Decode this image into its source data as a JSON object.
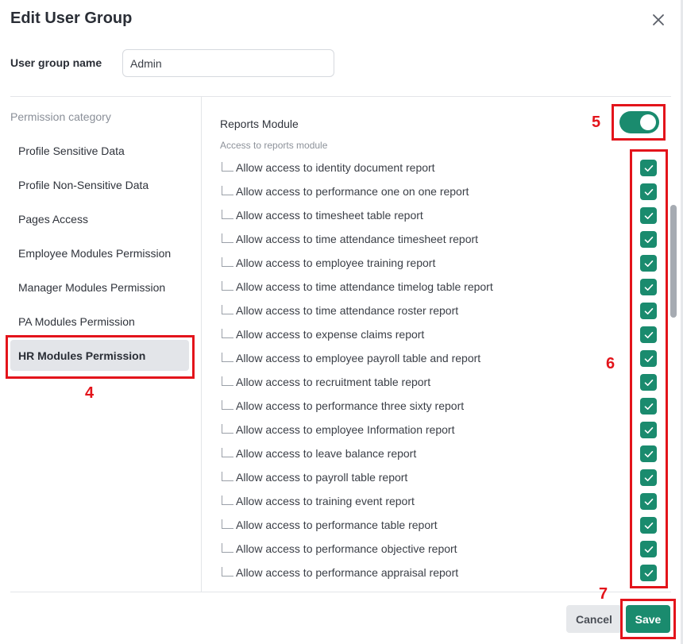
{
  "dialog": {
    "title": "Edit User Group"
  },
  "user_group": {
    "label": "User group name",
    "value": "Admin"
  },
  "categories": {
    "heading": "Permission category",
    "items": [
      {
        "label": "Profile Sensitive Data"
      },
      {
        "label": "Profile Non-Sensitive Data"
      },
      {
        "label": "Pages Access"
      },
      {
        "label": "Employee Modules Permission"
      },
      {
        "label": "Manager Modules Permission"
      },
      {
        "label": "PA Modules Permission"
      },
      {
        "label": "HR Modules Permission",
        "active": true
      }
    ]
  },
  "module": {
    "title": "Reports Module",
    "subtitle": "Access to reports module",
    "toggle_on": true,
    "permissions": [
      {
        "label": "Allow access to identity document report",
        "checked": true
      },
      {
        "label": "Allow access to performance one on one report",
        "checked": true
      },
      {
        "label": "Allow access to timesheet table report",
        "checked": true
      },
      {
        "label": "Allow access to time attendance timesheet report",
        "checked": true
      },
      {
        "label": "Allow access to employee training report",
        "checked": true
      },
      {
        "label": "Allow access to time attendance timelog table report",
        "checked": true
      },
      {
        "label": "Allow access to time attendance roster report",
        "checked": true
      },
      {
        "label": "Allow access to expense claims report",
        "checked": true
      },
      {
        "label": "Allow access to employee payroll table and report",
        "checked": true
      },
      {
        "label": "Allow access to recruitment table report",
        "checked": true
      },
      {
        "label": "Allow access to performance three sixty report",
        "checked": true
      },
      {
        "label": "Allow access to employee Information report",
        "checked": true
      },
      {
        "label": "Allow access to leave balance report",
        "checked": true
      },
      {
        "label": "Allow access to payroll table report",
        "checked": true
      },
      {
        "label": "Allow access to training event report",
        "checked": true
      },
      {
        "label": "Allow access to performance table report",
        "checked": true
      },
      {
        "label": "Allow access to performance objective report",
        "checked": true
      },
      {
        "label": "Allow access to performance appraisal report",
        "checked": true
      }
    ]
  },
  "footer": {
    "cancel_label": "Cancel",
    "save_label": "Save"
  },
  "annotations": {
    "n4": "4",
    "n5": "5",
    "n6": "6",
    "n7": "7"
  },
  "colors": {
    "accent": "#1a8b6e",
    "annotation": "#e3141b"
  }
}
